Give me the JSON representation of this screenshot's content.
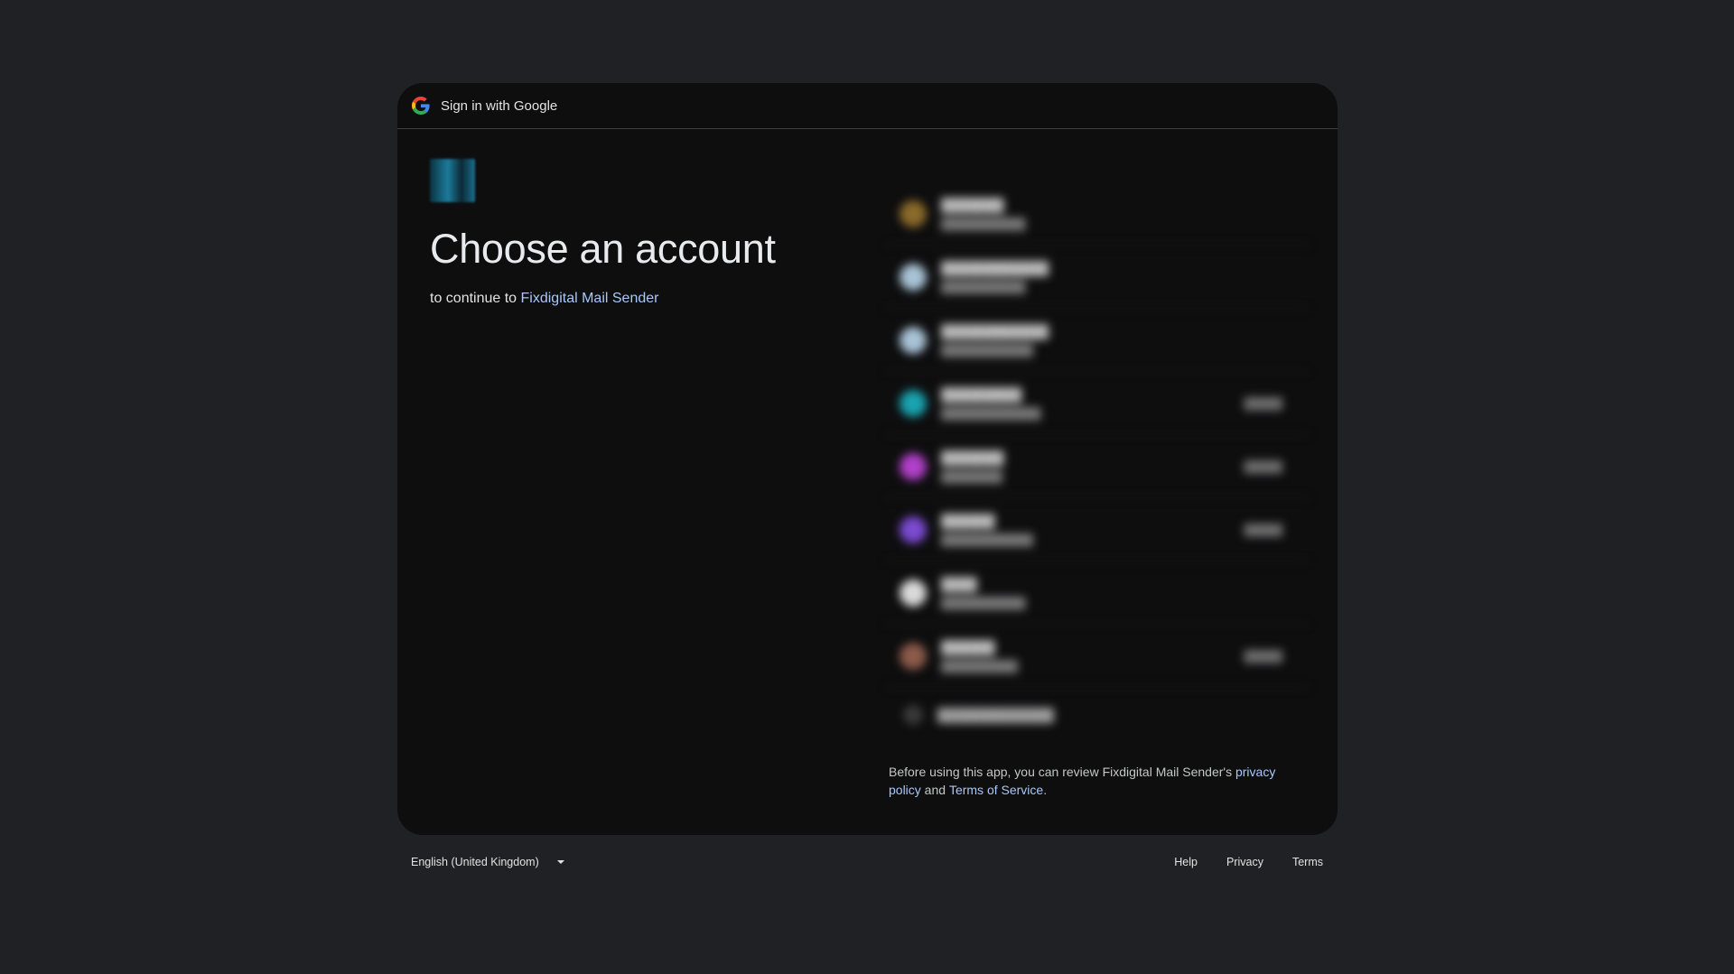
{
  "header": {
    "title": "Sign in with Google"
  },
  "main": {
    "headline": "Choose an account",
    "continue_prefix": "to continue to ",
    "app_name": "Fixdigital Mail Sender"
  },
  "accounts": [
    {
      "avatar_color": "#8a6a2a"
    },
    {
      "avatar_color": "#a9c3d6"
    },
    {
      "avatar_color": "#a9c3d6"
    },
    {
      "avatar_color": "#1aa3b0"
    },
    {
      "avatar_color": "#b040c8"
    },
    {
      "avatar_color": "#7a4ad0"
    },
    {
      "avatar_color": "#dadada"
    },
    {
      "avatar_color": "#8b5a4a"
    }
  ],
  "disclaimer": {
    "prefix": "Before using this app, you can review Fixdigital Mail Sender's ",
    "privacy_link": "privacy policy",
    "middle": " and ",
    "terms_link": "Terms of Service",
    "suffix": "."
  },
  "footer": {
    "language": "English (United Kingdom)",
    "help": "Help",
    "privacy": "Privacy",
    "terms": "Terms"
  },
  "colors": {
    "background": "#202124",
    "card": "#0e0e0f",
    "link": "#a8c7fa"
  }
}
